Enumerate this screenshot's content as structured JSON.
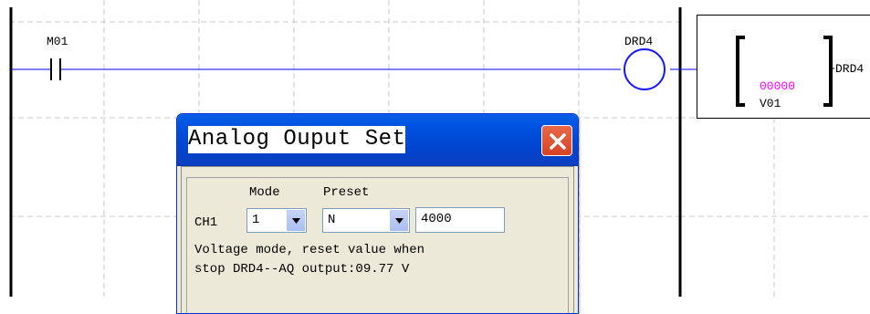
{
  "ladder": {
    "contact_label": "M01",
    "coil_label": "DRD4"
  },
  "function_block": {
    "value": "00000",
    "value_color": "#ff00ff",
    "register": "V01",
    "output_label": "DRD4"
  },
  "dialog": {
    "title": "Analog Ouput Set",
    "mode_header": "Mode",
    "preset_header": "Preset",
    "channel_label": "CH1",
    "mode_value": "1",
    "preset_value": "N",
    "preset_input": "4000",
    "description_line1": "Voltage mode, reset value when",
    "description_line2": "stop    DRD4--AQ output:09.77 V"
  },
  "icons": {
    "close": "close-x-icon",
    "dropdown": "chevron-down-icon"
  },
  "colors": {
    "titlebar_blue": "#0054e3",
    "close_red": "#d84324",
    "coil_blue": "#1a1aff",
    "rung_blue": "#0000ff"
  }
}
